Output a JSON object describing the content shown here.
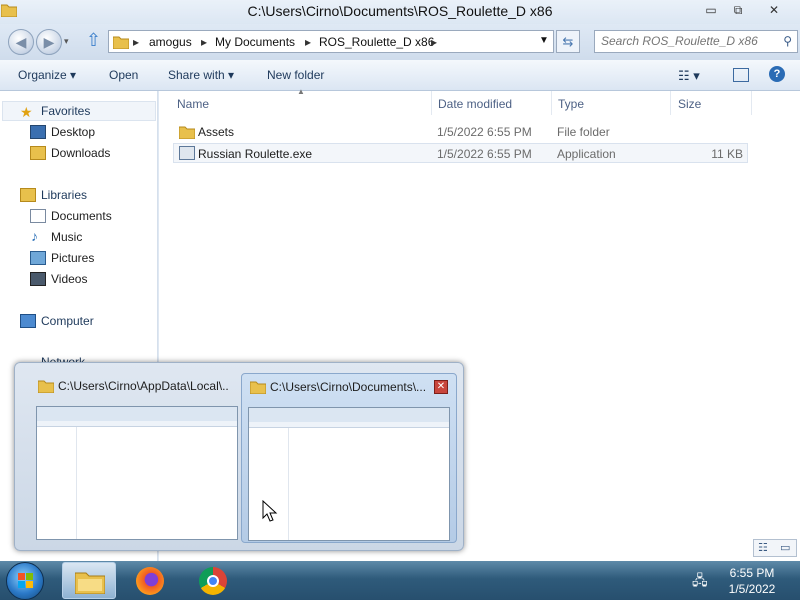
{
  "window": {
    "title": "C:\\Users\\Cirno\\Documents\\ROS_Roulette_D x86",
    "controls": {
      "minimize": "▭",
      "maximize": "⧉",
      "close": "✕"
    }
  },
  "address": {
    "crumbs": [
      "amogus",
      "My Documents",
      "ROS_Roulette_D x86"
    ],
    "search_placeholder": "Search ROS_Roulette_D x86"
  },
  "toolbar": {
    "organize": "Organize ▾",
    "open": "Open",
    "share": "Share with ▾",
    "new_folder": "New folder"
  },
  "nav": {
    "favorites": "Favorites",
    "desktop": "Desktop",
    "downloads": "Downloads",
    "libraries": "Libraries",
    "documents": "Documents",
    "music": "Music",
    "pictures": "Pictures",
    "videos": "Videos",
    "computer": "Computer",
    "network": "Network"
  },
  "columns": {
    "name": "Name",
    "date": "Date modified",
    "type": "Type",
    "size": "Size"
  },
  "files": [
    {
      "name": "Assets",
      "date": "1/5/2022 6:55 PM",
      "type": "File folder",
      "size": ""
    },
    {
      "name": "Russian Roulette.exe",
      "date": "1/5/2022 6:55 PM",
      "type": "Application",
      "size": "11 KB"
    }
  ],
  "previews": [
    {
      "title": "C:\\Users\\Cirno\\AppData\\Local\\..."
    },
    {
      "title": "C:\\Users\\Cirno\\Documents\\..."
    }
  ],
  "tray": {
    "time": "6:55 PM",
    "date": "1/5/2022"
  },
  "colors": {
    "accent": "#1e395b",
    "taskbar": "#2f5b7b"
  }
}
